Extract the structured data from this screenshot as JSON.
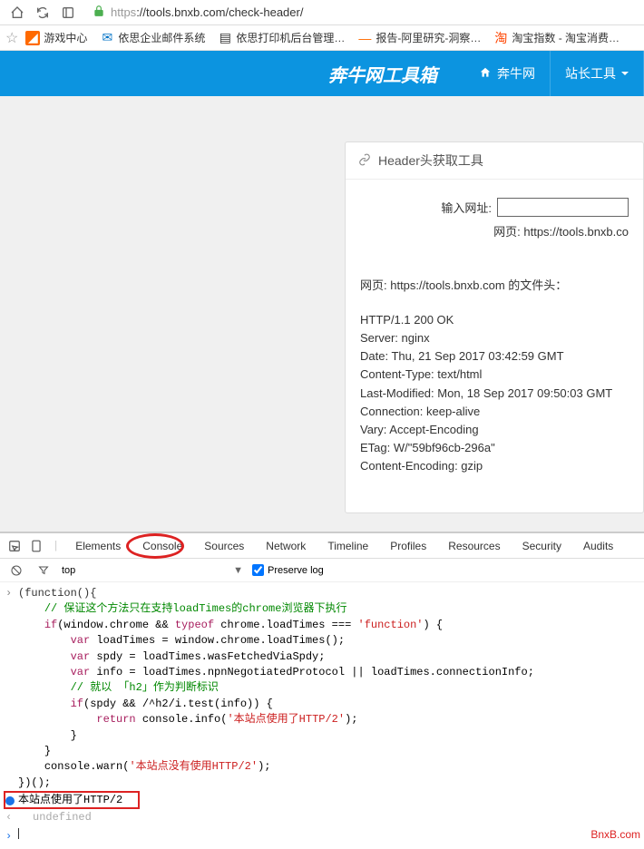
{
  "browser": {
    "url_proto": "https",
    "url_rest": "://tools.bnxb.com/check-header/"
  },
  "bookmarks": [
    {
      "label": "游戏中心",
      "icon": "uc"
    },
    {
      "label": "依思企业邮件系统",
      "icon": "outlook"
    },
    {
      "label": "依思打印机后台管理…",
      "icon": "page"
    },
    {
      "label": "报告-阿里研究-洞察…",
      "icon": "ali"
    },
    {
      "label": "淘宝指数 - 淘宝消费…",
      "icon": "tb"
    }
  ],
  "header": {
    "brand": "奔牛网工具箱",
    "home": "奔牛网",
    "tools": "站长工具"
  },
  "panel": {
    "title": "Header头获取工具",
    "input_label": "输入网址:",
    "sub_prefix": "网页: ",
    "sub_url": "https://tools.bnxb.co",
    "result_title": "网页: https://tools.bnxb.com 的文件头：",
    "headers": [
      "HTTP/1.1 200 OK",
      "Server: nginx",
      "Date: Thu, 21 Sep 2017 03:42:59 GMT",
      "Content-Type: text/html",
      "Last-Modified: Mon, 18 Sep 2017 09:50:03 GMT",
      "Connection: keep-alive",
      "Vary: Accept-Encoding",
      "ETag: W/\"59bf96cb-296a\"",
      "Content-Encoding: gzip"
    ]
  },
  "devtools": {
    "tabs": [
      "Elements",
      "Console",
      "Sources",
      "Network",
      "Timeline",
      "Profiles",
      "Resources",
      "Security",
      "Audits"
    ],
    "filter_context": "top",
    "preserve_log": "Preserve log",
    "info_msg": "本站点使用了HTTP/2",
    "undef": "undefined"
  },
  "code": {
    "l1": "(function(){",
    "l2a": "// 保证这个方法只在支持",
    "l2b": "loadTimes",
    "l2c": "的",
    "l2d": "chrome",
    "l2e": "浏览器下执行",
    "l3a": "if",
    "l3b": "(window.chrome && ",
    "l3c": "typeof",
    "l3d": " chrome.loadTimes === ",
    "l3e": "'function'",
    "l3f": ") {",
    "l4a": "var",
    "l4b": " loadTimes = window.chrome.loadTimes();",
    "l5a": "var",
    "l5b": " spdy = loadTimes.wasFetchedViaSpdy;",
    "l6a": "var",
    "l6b": " info = loadTimes.npnNegotiatedProtocol || loadTimes.connectionInfo;",
    "l7": "// 就以 「h2」作为判断标识",
    "l8a": "if",
    "l8b": "(spdy && /^h2/i.test(info)) {",
    "l9a": "return",
    "l9b": " console.info(",
    "l9c": "'本站点使用了HTTP/2'",
    "l9d": ");",
    "l10": "}",
    "l11": "}",
    "l12a": "console.warn(",
    "l12b": "'本站点没有使用HTTP/2'",
    "l12c": ");",
    "l13": "})();"
  },
  "watermark": "BnxB.com"
}
